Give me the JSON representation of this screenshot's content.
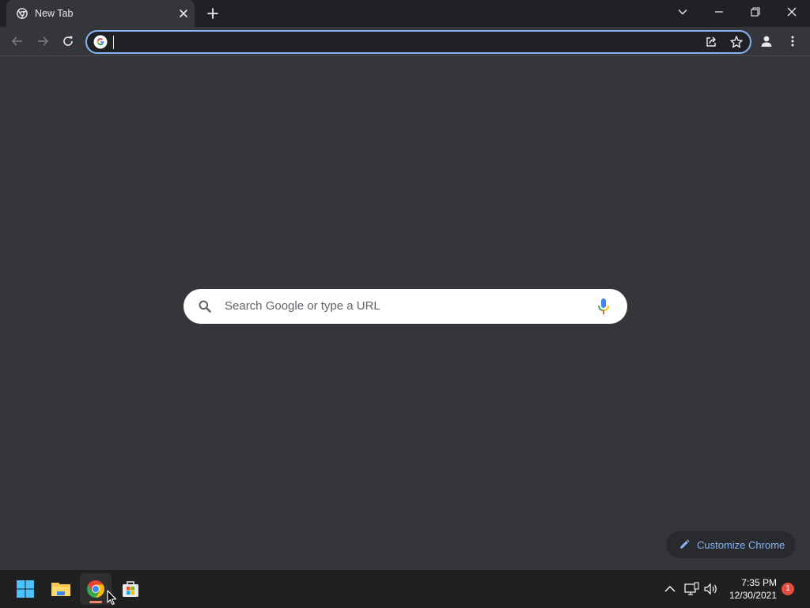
{
  "browser": {
    "tab": {
      "title": "New Tab"
    },
    "omnibox": {
      "value": "",
      "placeholder": ""
    }
  },
  "ntp": {
    "search_placeholder": "Search Google or type a URL",
    "customize_label": "Customize Chrome"
  },
  "taskbar": {
    "apps": [
      "windows-start",
      "file-explorer",
      "google-chrome",
      "microsoft-store"
    ],
    "time": "7:35 PM",
    "date": "12/30/2021",
    "notification_count": "1"
  },
  "colors": {
    "background": "#35363a",
    "titlebar": "#202124",
    "accent": "#8ab4f8",
    "taskbar": "#202020"
  }
}
